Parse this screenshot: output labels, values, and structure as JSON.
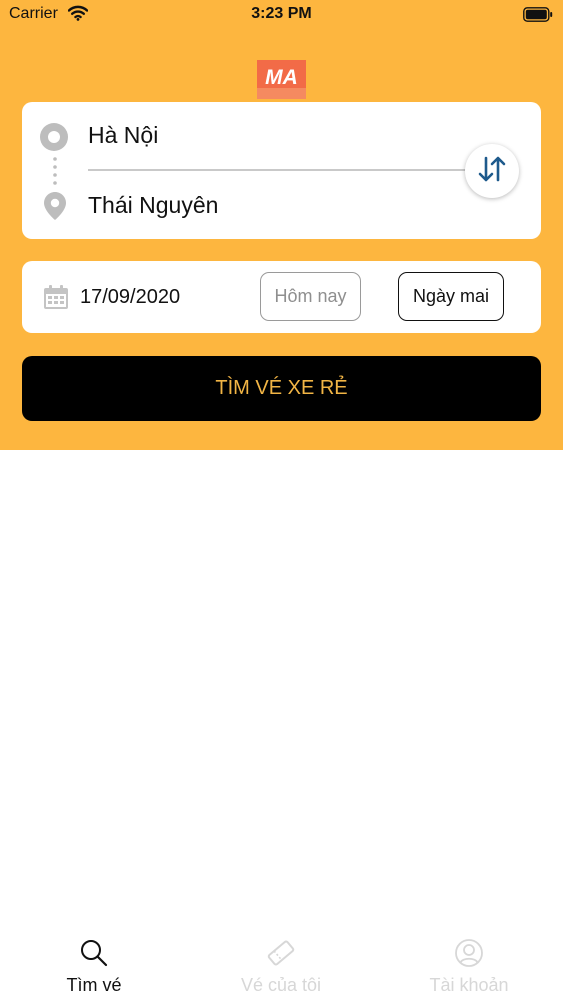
{
  "status_bar": {
    "carrier": "Carrier",
    "time": "3:23 PM"
  },
  "colors": {
    "header_background": "#FDB63F",
    "search_button_background": "#000000",
    "search_button_text": "#F2B545",
    "swap_icon": "#1E5A8C",
    "inactive_tab": "#D7D7D7"
  },
  "logo": {
    "text": "MA",
    "icon": "brand-logo"
  },
  "route": {
    "origin": "Hà Nội",
    "destination": "Thái Nguyên",
    "origin_icon": "origin-circle-icon",
    "destination_icon": "location-pin-icon",
    "swap_icon": "swap-arrows-icon"
  },
  "date": {
    "value": "17/09/2020",
    "icon": "calendar-icon",
    "today_label": "Hôm nay",
    "tomorrow_label": "Ngày mai",
    "selected": "tomorrow"
  },
  "search_button": {
    "label": "TÌM VÉ XE RẺ"
  },
  "tabs": [
    {
      "label": "Tìm vé",
      "icon": "search-icon",
      "active": true
    },
    {
      "label": "Vé của tôi",
      "icon": "ticket-icon",
      "active": false
    },
    {
      "label": "Tài khoản",
      "icon": "user-icon",
      "active": false
    }
  ]
}
